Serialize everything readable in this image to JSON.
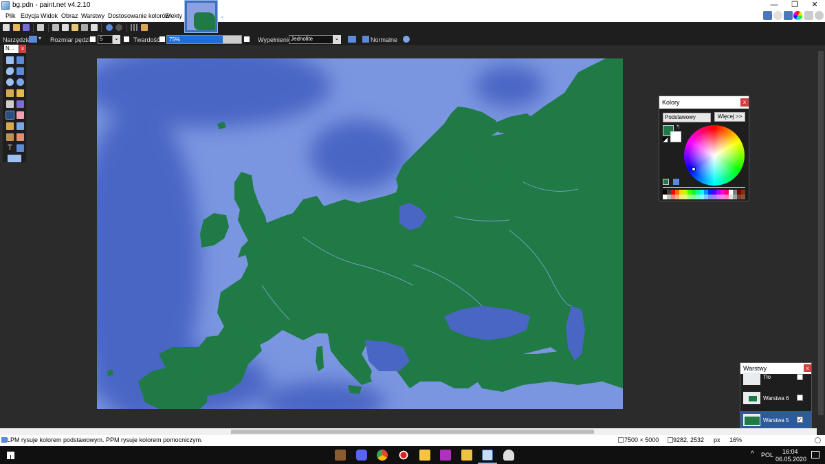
{
  "window": {
    "title": "bg.pdn - paint.net v4.2.10",
    "minimize": "—",
    "restore": "❐",
    "close": "✕"
  },
  "menu": [
    "Plik",
    "Edycja",
    "Widok",
    "Obraz",
    "Warstwy",
    "Dostosowanie kolorów",
    "Efekty"
  ],
  "toolbar": {
    "tool_label": "Narzędzie:",
    "brush_size_label": "Rozmiar pędzla:",
    "brush_size_value": "5",
    "hardness_label": "Twardość:",
    "hardness_value": "75%",
    "hardness_fraction": 0.75,
    "fill_label": "Wypełnienie:",
    "fill_value": "Jednolite",
    "blend_mode": "Normalne"
  },
  "tools_panel": {
    "title": "N...",
    "close": "x",
    "tools": [
      "rectangle-select",
      "move-selection",
      "lasso-select",
      "move-selected",
      "ellipse-select",
      "zoom",
      "magic-wand",
      "pan",
      "paint-bucket",
      "gradient",
      "paintbrush",
      "eraser",
      "pencil",
      "color-picker",
      "clone-stamp",
      "recolor",
      "text",
      "line-curve",
      "shapes"
    ],
    "active_tool": "paintbrush"
  },
  "colors_panel": {
    "title": "Kolory",
    "close": "x",
    "palette_mode": "Podstawowy",
    "more_button": "Więcej >>",
    "primary_color": "#1f7a45",
    "secondary_color": "#ffffff",
    "palette": [
      "#000000",
      "#404040",
      "#ff0000",
      "#ff6a00",
      "#ffd800",
      "#b6ff00",
      "#4cff00",
      "#00ff21",
      "#00ff90",
      "#00ffff",
      "#0094ff",
      "#0026ff",
      "#4800ff",
      "#b200ff",
      "#ff00dc",
      "#ff006e",
      "#ffffff",
      "#808080",
      "#7f0000",
      "#7f3300",
      "#ffffff",
      "#c0c0c0",
      "#ff7f7f",
      "#ffb27f",
      "#ffe97f",
      "#daff7f",
      "#a5ff7f",
      "#7fff8e",
      "#7fffc5",
      "#7fffff",
      "#7fc9ff",
      "#7f92ff",
      "#a17fff",
      "#d67fff",
      "#ff7fed",
      "#ff7fb6",
      "#e0e0e0",
      "#a0a0a0",
      "#7f3f3f",
      "#7f593f"
    ]
  },
  "layers_panel": {
    "title": "Warstwy",
    "close": "x",
    "layers": [
      {
        "name": "Tło",
        "visible": true,
        "selected": false
      },
      {
        "name": "Warstwa 6",
        "visible": false,
        "selected": false
      },
      {
        "name": "Warstwa 5",
        "visible": true,
        "selected": true
      }
    ]
  },
  "status": {
    "hint": "LPM rysuje kolorem podstawowym. PPM rysuje kolorem pomocniczym.",
    "image_size": "7500 × 5000",
    "cursor_pos": "9282, 2532",
    "unit": "px",
    "zoom": "16%"
  },
  "taskbar": {
    "language": "POL",
    "time": "16:04",
    "date": "06.05.2020"
  },
  "colors": {
    "sea": "#7b96e0",
    "deep_sea": "#4a66c4",
    "land": "#1f7a45",
    "accent": "#2c5a9a"
  }
}
